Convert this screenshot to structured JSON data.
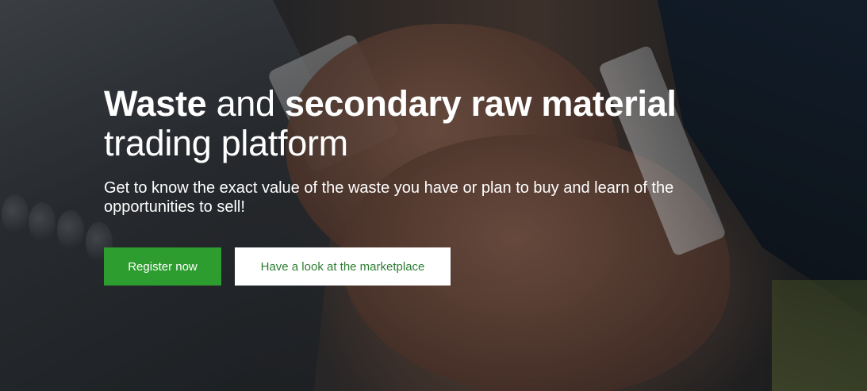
{
  "hero": {
    "headline": {
      "part1_bold": "Waste",
      "part2": " and ",
      "part3_bold": "secondary raw material",
      "part4": "trading platform"
    },
    "subtitle": "Get to know the exact value of the waste you have or plan to buy and learn of the opportunities to sell!",
    "primary_button": "Register now",
    "secondary_button": "Have a look at the marketplace",
    "background_image": "handshake-photo"
  },
  "colors": {
    "primary_green": "#2e9d2f",
    "secondary_text_green": "#2e7d32",
    "text_white": "#ffffff"
  }
}
